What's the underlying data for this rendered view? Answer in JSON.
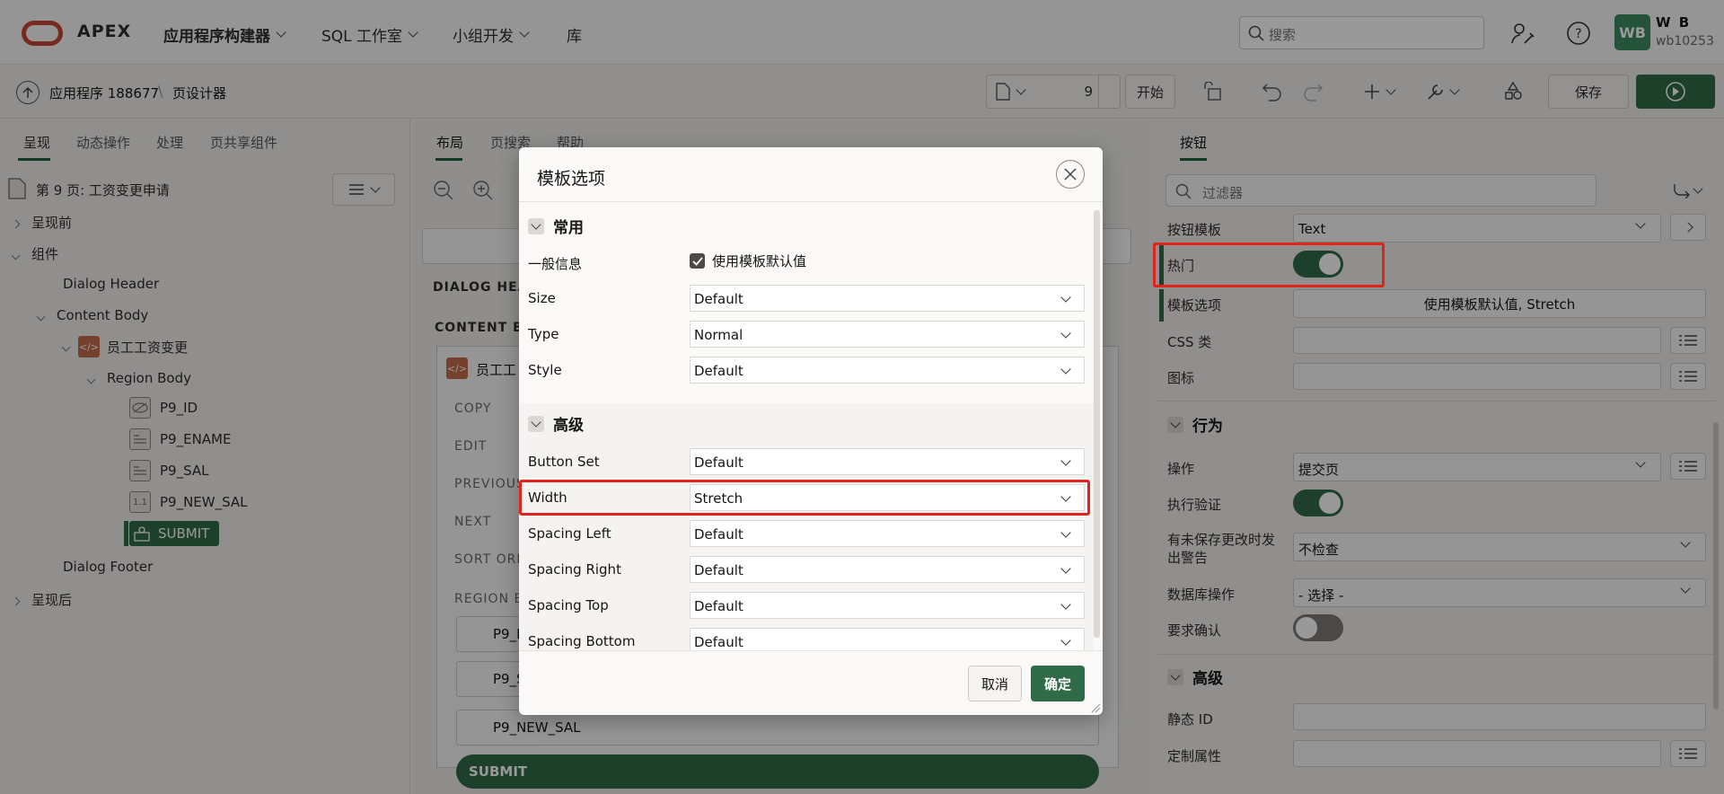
{
  "topbar": {
    "brand": "APEX",
    "nav": [
      "应用程序构建器",
      "SQL 工作室",
      "小组开发",
      "库"
    ],
    "search_placeholder": "搜索",
    "user_initials": "WB",
    "user_name": "W B",
    "user_id": "wb10253"
  },
  "toolbar": {
    "crumb_app": "应用程序 188677",
    "crumb_page": "页设计器",
    "page_number": "9",
    "go_label": "开始",
    "save_label": "保存"
  },
  "left": {
    "tabs": [
      "呈现",
      "动态操作",
      "处理",
      "页共享组件"
    ],
    "page_title": "第 9 页: 工资变更申请",
    "tree": {
      "before": "呈现前",
      "components": "组件",
      "dialog_header": "Dialog Header",
      "content_body": "Content Body",
      "region": "员工工资变更",
      "region_body": "Region Body",
      "items": [
        "P9_ID",
        "P9_ENAME",
        "P9_SAL",
        "P9_NEW_SAL"
      ],
      "button": "SUBMIT",
      "dialog_footer": "Dialog Footer",
      "after": "呈现后"
    }
  },
  "center": {
    "tabs": [
      "布局",
      "页搜索",
      "帮助"
    ],
    "dialog_header": "DIALOG HEAD",
    "content_body": "CONTENT BO",
    "region_title": "员工工",
    "slots": [
      "COPY",
      "EDIT",
      "PREVIOUS",
      "NEXT",
      "SORT ORD"
    ],
    "region_body": "REGION BO",
    "fields": [
      "P9_E",
      "P9_S",
      "P9_NEW_SAL"
    ],
    "submit": "SUBMIT"
  },
  "right": {
    "tab": "按钮",
    "filter_placeholder": "过滤器",
    "button_template_label": "按钮模板",
    "button_template_value": "Text",
    "hot_label": "热门",
    "hot_on": true,
    "template_options_label": "模板选项",
    "template_options_value": "使用模板默认值, Stretch",
    "css_label": "CSS 类",
    "icon_label": "图标",
    "behavior_head": "行为",
    "action_label": "操作",
    "action_value": "提交页",
    "validate_label": "执行验证",
    "validate_on": true,
    "warn_label_1": "有未保存更改时发",
    "warn_label_2": "出警告",
    "warn_value": "不检查",
    "db_label": "数据库操作",
    "db_value": "- 选择 -",
    "confirm_label": "要求确认",
    "confirm_on": false,
    "advanced_head": "高级",
    "static_id_label": "静态 ID",
    "custom_attr_label": "定制属性"
  },
  "dialog": {
    "title": "模板选项",
    "common_head": "常用",
    "general_label": "一般信息",
    "use_default_label": "使用模板默认值",
    "use_default_checked": true,
    "size_label": "Size",
    "size_value": "Default",
    "type_label": "Type",
    "type_value": "Normal",
    "style_label": "Style",
    "style_value": "Default",
    "advanced_head": "高级",
    "buttonset_label": "Button Set",
    "buttonset_value": "Default",
    "width_label": "Width",
    "width_value": "Stretch",
    "spl_label": "Spacing Left",
    "spl_value": "Default",
    "spr_label": "Spacing Right",
    "spr_value": "Default",
    "spt_label": "Spacing Top",
    "spt_value": "Default",
    "spb_label": "Spacing Bottom",
    "spb_value": "Default",
    "cancel_label": "取消",
    "ok_label": "确定"
  },
  "colors": {
    "accent": "#2f6b47",
    "highlight": "#e0241b",
    "oracle_red": "#c74634"
  }
}
